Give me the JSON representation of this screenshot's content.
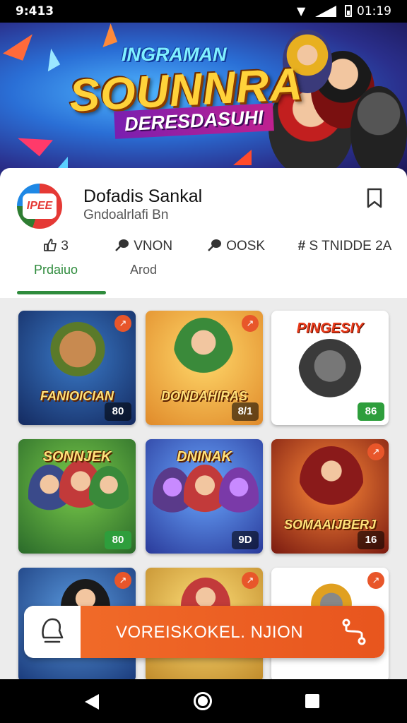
{
  "status_bar": {
    "time_left": "9:413",
    "time_right": "01:19"
  },
  "banner": {
    "title_top": "INGRAMAN",
    "title_main": "SOUNNRA",
    "title_sub": "DERESDASUHI"
  },
  "app": {
    "logo_text": "IPEE",
    "title": "Dofadis Sankal",
    "subtitle": "Gndoalrlafi Bn"
  },
  "tabs": [
    {
      "icon": "thumbs-up-icon",
      "top": "3",
      "bottom": "Prdaiuo",
      "active": true
    },
    {
      "icon": "pin-icon",
      "top": "VNON",
      "bottom": "Arod",
      "active": false
    },
    {
      "icon": "pin-icon",
      "top": "OOSK",
      "bottom": "",
      "active": false
    },
    {
      "icon": "hash-icon",
      "top": "S TNIDDE 2A",
      "bottom": "",
      "active": false
    }
  ],
  "games": [
    {
      "title": "FANIOICIAN",
      "title_pos": "bottom",
      "badge": "80",
      "badge_style": "dark",
      "fav": true
    },
    {
      "title": "DONDAHIRAS",
      "title_pos": "bottom",
      "badge": "8/1",
      "badge_style": "dark",
      "fav": true
    },
    {
      "title": "PINGESIY",
      "title_pos": "top",
      "badge": "86",
      "badge_style": "green",
      "fav": false
    },
    {
      "title": "SONNJEK",
      "title_pos": "top",
      "badge": "80",
      "badge_style": "green",
      "fav": false
    },
    {
      "title": "DNINAK",
      "title_pos": "top",
      "badge": "9D",
      "badge_style": "dark",
      "fav": false
    },
    {
      "title": "SOMAAIJBERJ",
      "title_pos": "bottom",
      "badge": "16",
      "badge_style": "dark",
      "fav": true
    },
    {
      "title": "",
      "title_pos": "bottom",
      "badge": "",
      "badge_style": "dark",
      "fav": true
    },
    {
      "title": "",
      "title_pos": "bottom",
      "badge": "",
      "badge_style": "dark",
      "fav": true
    },
    {
      "title": "",
      "title_pos": "bottom",
      "badge": "",
      "badge_style": "dark",
      "fav": true
    }
  ],
  "action_bar": {
    "label": "VOREISKOKEL. NJION"
  },
  "colors": {
    "accent_green": "#2e8b3c",
    "action_orange": "#e8551e"
  }
}
